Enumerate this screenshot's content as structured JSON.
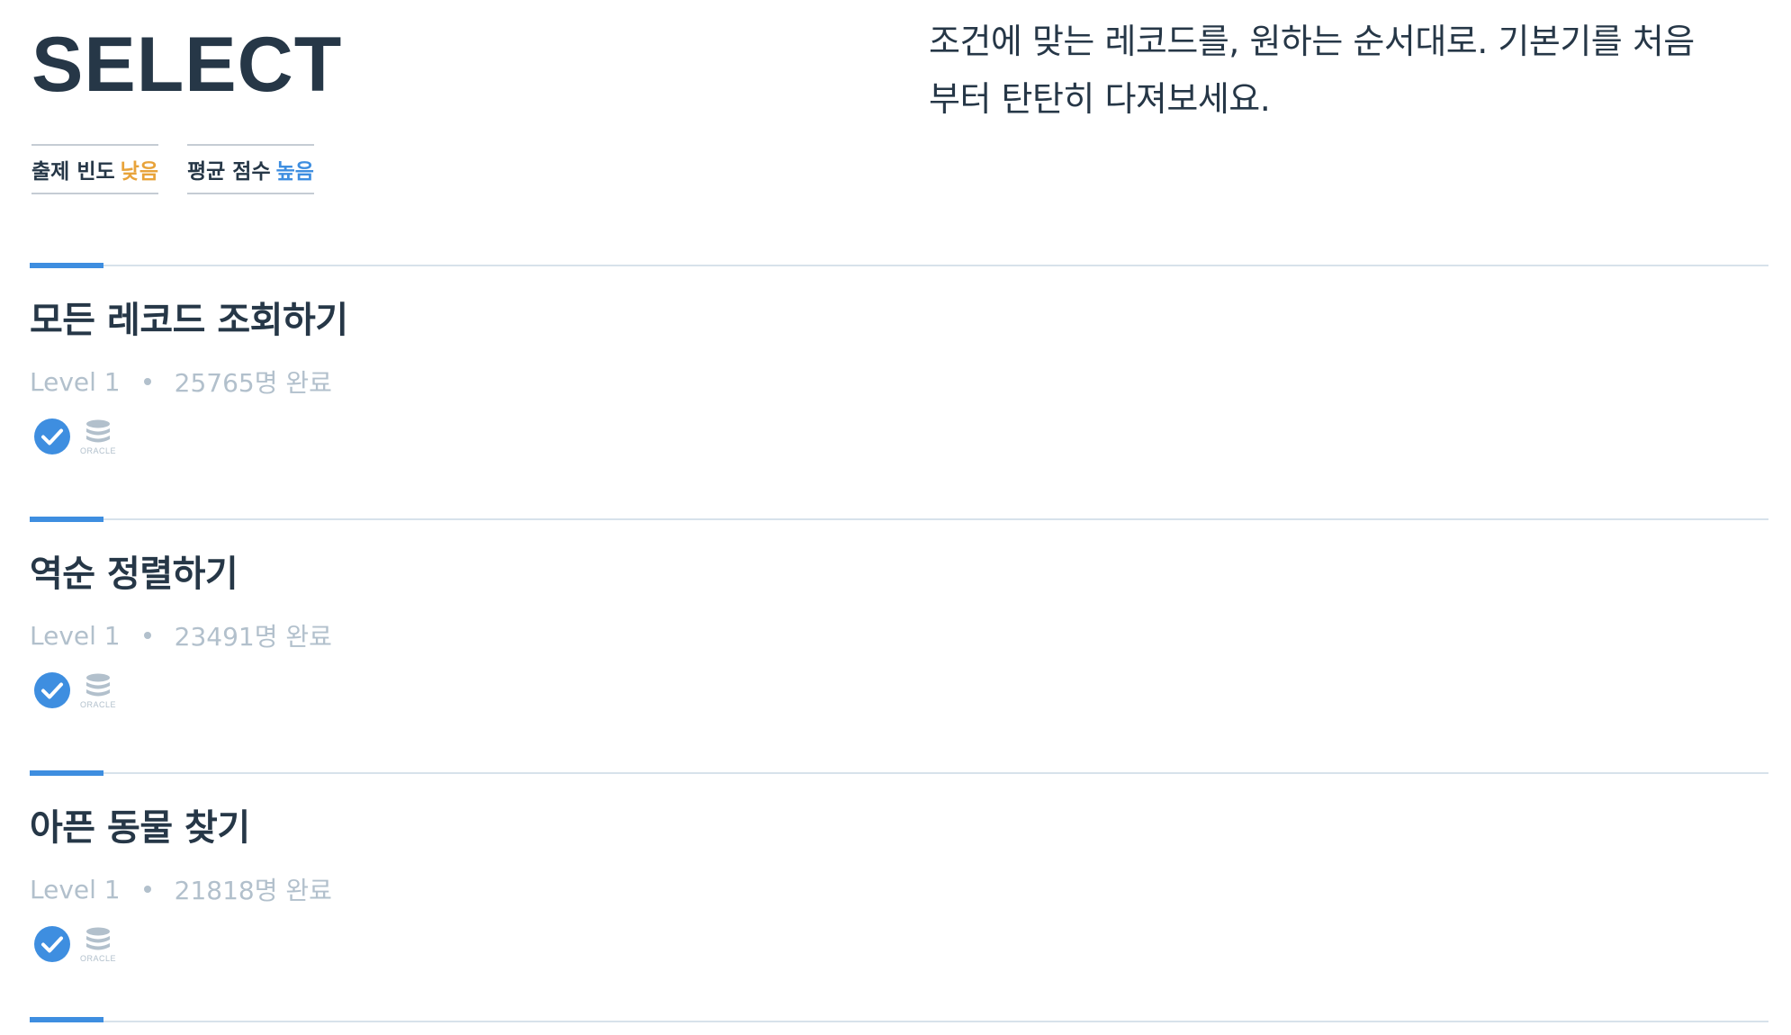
{
  "header": {
    "title": "SELECT",
    "description": "조건에 맞는 레코드를, 원하는 순서대로. 기본기를 처음부터 탄탄히 다져보세요.",
    "stats": [
      {
        "label": "출제 빈도",
        "value": "낮음",
        "value_color": "#e8a33a"
      },
      {
        "label": "평균 점수",
        "value": "높음",
        "value_color": "#3e8ee0"
      }
    ]
  },
  "problems": [
    {
      "title": "모든 레코드 조회하기",
      "level": "Level 1",
      "completed": "25765명 완료",
      "status_icon": "check-circle-icon",
      "db_icon": "oracle-icon",
      "db_label": "ORACLE"
    },
    {
      "title": "역순 정렬하기",
      "level": "Level 1",
      "completed": "23491명 완료",
      "status_icon": "check-circle-icon",
      "db_icon": "oracle-icon",
      "db_label": "ORACLE"
    },
    {
      "title": "아픈 동물 찾기",
      "level": "Level 1",
      "completed": "21818명 완료",
      "status_icon": "check-circle-icon",
      "db_icon": "oracle-icon",
      "db_label": "ORACLE"
    }
  ],
  "colors": {
    "accent": "#3e8ee0",
    "text": "#263747",
    "muted": "#b2c0cc",
    "divider": "#d7e2eb"
  }
}
